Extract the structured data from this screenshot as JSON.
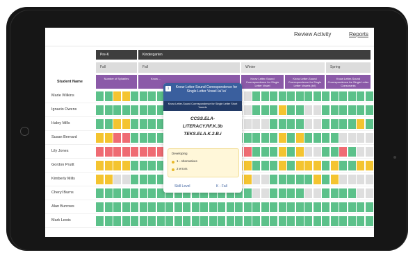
{
  "nav": {
    "review_activity": "Review Activity",
    "reports": "Reports"
  },
  "grade_bands": {
    "prek": "Pre-K",
    "kindergarten": "Kindergarten"
  },
  "season_bands": {
    "fall_prek": "Fall",
    "fall_k": "Fall",
    "winter": "Winter",
    "spring": "Spring"
  },
  "table": {
    "student_name_header": "Student Name"
  },
  "phase_headers": [
    "Number of Syllables",
    "Know ...",
    "Know Letter-Sound Correspondence for Single Letter Vowel",
    "Know Letter-Sound Correspondence for Single Letter Vowels (b/i)",
    "Know Letter-Sound Correspondence for Single Letter Consonants"
  ],
  "students": [
    {
      "name": "Marie Wilkins",
      "cells": "GGYYGGGGGGGGGGGGXXGGGGGGGGGGGGGG"
    },
    {
      "name": "Ignacio Owens",
      "cells": "GGGGGGGGGGGGGGGGXXGGGYGGXXGGGGGG"
    },
    {
      "name": "Haley Mills",
      "cells": "GGYYGGGGGGGGGGGGXXXXGGGGXXGGGGYG"
    },
    {
      "name": "Susan Bernard",
      "cells": "YYRRGGGGGGGGGGGGGGGGGYGYGGGGXXXX"
    },
    {
      "name": "Lily Jones",
      "cells": "RRRRRRRRRRGGGGGGRRGGGYGYXXGGRGXX"
    },
    {
      "name": "Gordon Pruitt",
      "cells": "YYYYGGGGGGGGGGGGYYGGGYGYYYGYGGYY"
    },
    {
      "name": "Kimberly Mills",
      "cells": "YYXXGGGGGGGGGGGGYYXXGGGGGYGYXXXX"
    },
    {
      "name": "Cheryl Burns",
      "cells": "GGGGGGGGGGGGGGGGGGXXGGGGXXGGGGXX"
    },
    {
      "name": "Alan Burrows",
      "cells": "GGGGGGGGGGGGGGGGGGGGGGGGGGGGGGGG"
    },
    {
      "name": "Mark Lewis",
      "cells": "GGGGGGGGGGGGGGGGGGGGGGGGGGGGGGGG"
    }
  ],
  "popup": {
    "number": "1",
    "title": "Know Letter-Sound Correspondence for Single Letter Vowel /a/ /e/",
    "subtitle": "Know Letter-Sound Correspondence for Single Letter Short Vowels",
    "codes": [
      "CCSS.ELA-",
      "LITERACY.RF.K.3b",
      "TEKS.ELA.K.2.B.i"
    ],
    "developing_label": "Developing",
    "developing_items": [
      "1 - Alternatives",
      "2 errors"
    ],
    "skill_level_link": "Skill Level",
    "k_fall_link": "K - Fall"
  },
  "colors": {
    "green": "#5cc18a",
    "yellow": "#f4c430",
    "red": "#ef6b73",
    "grey": "#dedede",
    "purple": "#8b5aa8",
    "navy": "#3a5f9e"
  }
}
